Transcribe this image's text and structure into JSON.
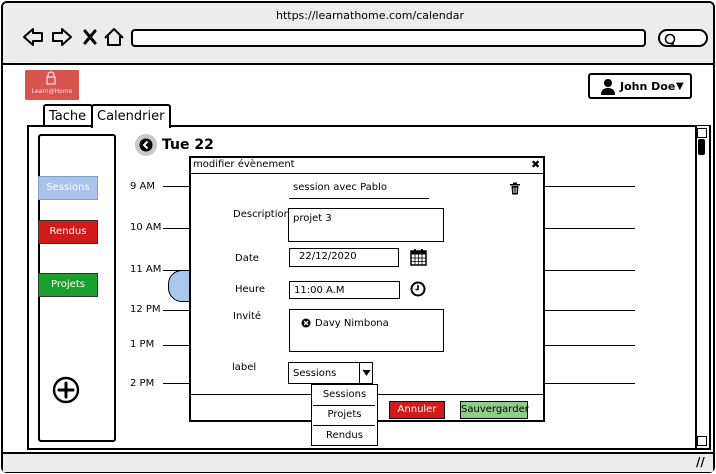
{
  "browser": {
    "url": "https://learnathome.com/calendar",
    "icons": [
      "back-arrow-icon",
      "forward-arrow-icon",
      "close-x-icon",
      "home-icon",
      "search-icon"
    ]
  },
  "app": {
    "logo_text": "Learn@Home",
    "logo_icon": "lock-icon",
    "user_name": "John Doe",
    "user_icon": "user-icon",
    "user_caret": "▼"
  },
  "tabs": [
    {
      "label": "Tache"
    },
    {
      "label": "Calendrier"
    }
  ],
  "calendar": {
    "day": "Tue 22",
    "hours": [
      "9 AM",
      "10 AM",
      "11 AM",
      "12 PM",
      "1 PM",
      "2 PM"
    ]
  },
  "sidebar": {
    "labels": [
      {
        "name": "Sessions",
        "color": "#a9c3ea"
      },
      {
        "name": "Rendus",
        "color": "#d11a1a"
      },
      {
        "name": "Projets",
        "color": "#1a9f2c"
      }
    ],
    "add_icon": "plus-circle-icon"
  },
  "modal": {
    "title": "modifier évènement",
    "close": "✖",
    "event_title": "session avec Pablo",
    "description_label": "Description",
    "description_value": "projet 3",
    "date_label": "Date",
    "date_value": "22/12/2020",
    "time_label": "Heure",
    "time_value": "11:00 A.M",
    "invite_label": "Invité",
    "invitee": "Davy Nimbona",
    "label_label": "label",
    "label_value": "Sessions",
    "label_options": [
      "Sessions",
      "Projets",
      "Rendus"
    ],
    "cancel_label": "Annuler",
    "save_label": "Sauvergarder",
    "cancel_color": "#d11a1a",
    "save_color": "#8fce8a"
  }
}
